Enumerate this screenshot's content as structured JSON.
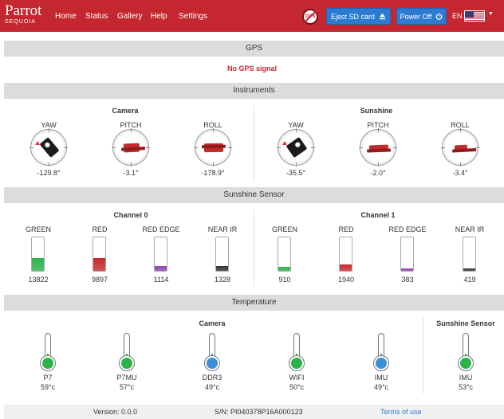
{
  "nav": {
    "brand": "Parrot",
    "brand_sub": "SEQUOIA",
    "links": [
      "Home",
      "Status",
      "Gallery",
      "Help",
      "Settings"
    ],
    "gps_icon_text": "GPS",
    "eject_label": "Eject SD card",
    "power_label": "Power Off",
    "lang": "EN",
    "colors": {
      "bar": "#c4272f",
      "button": "#2b7bd4"
    }
  },
  "gps": {
    "title": "GPS",
    "status": "No GPS signal"
  },
  "instruments": {
    "title": "Instruments",
    "camera": {
      "title": "Camera",
      "gauges": [
        {
          "label": "YAW",
          "value": "-129.8°",
          "icon": "camera-top-view"
        },
        {
          "label": "PITCH",
          "value": "-3.1°",
          "icon": "camera-side-view"
        },
        {
          "label": "ROLL",
          "value": "-178.9°",
          "icon": "camera-front-view"
        }
      ]
    },
    "sunshine": {
      "title": "Sunshine",
      "gauges": [
        {
          "label": "YAW",
          "value": "-35.5°",
          "icon": "sensor-top-view"
        },
        {
          "label": "PITCH",
          "value": "-2.0°",
          "icon": "sensor-side-view"
        },
        {
          "label": "ROLL",
          "value": "-3.4°",
          "icon": "sensor-front-view"
        }
      ]
    }
  },
  "sunshine_sensor": {
    "title": "Sunshine Sensor",
    "channels": [
      {
        "title": "Channel 0",
        "bands": [
          {
            "label": "GREEN",
            "value": "13822",
            "level": 0.38,
            "color": "#2db24a"
          },
          {
            "label": "RED",
            "value": "9897",
            "level": 0.38,
            "color": "#c52a2a"
          },
          {
            "label": "RED EDGE",
            "value": "1114",
            "level": 0.15,
            "color": "#8e44ad"
          },
          {
            "label": "NEAR IR",
            "value": "1328",
            "level": 0.15,
            "color": "#333333"
          }
        ]
      },
      {
        "title": "Channel 1",
        "bands": [
          {
            "label": "GREEN",
            "value": "910",
            "level": 0.12,
            "color": "#2db24a"
          },
          {
            "label": "RED",
            "value": "1940",
            "level": 0.18,
            "color": "#c52a2a"
          },
          {
            "label": "RED EDGE",
            "value": "383",
            "level": 0.06,
            "color": "#8e44ad"
          },
          {
            "label": "NEAR IR",
            "value": "419",
            "level": 0.06,
            "color": "#333333"
          }
        ]
      }
    ]
  },
  "temperature": {
    "title": "Temperature",
    "camera_title": "Camera",
    "sunshine_title": "Sunshine Sensor",
    "items": [
      {
        "label": "P7",
        "value": "59°c",
        "color": "#2db24a"
      },
      {
        "label": "P7MU",
        "value": "57°c",
        "color": "#2db24a"
      },
      {
        "label": "DDR3",
        "value": "49°c",
        "color": "#3a8fd6"
      },
      {
        "label": "WIFI",
        "value": "50°c",
        "color": "#2db24a"
      },
      {
        "label": "IMU",
        "value": "49°c",
        "color": "#3a8fd6"
      },
      {
        "label": "IMU",
        "value": "53°c",
        "color": "#2db24a"
      }
    ]
  },
  "footer": {
    "version": "Version: 0.0.0",
    "serial": "S/N: PI040378P16A000123",
    "terms": "Terms of use"
  }
}
